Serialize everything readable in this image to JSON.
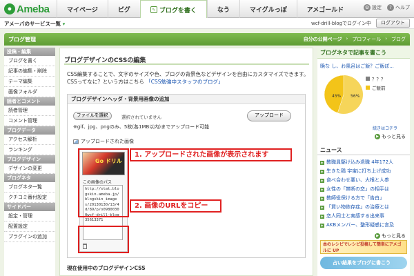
{
  "topnav": {
    "logo": "Ameba",
    "tabs": [
      "マイページ",
      "ピグ",
      "ブログを書く",
      "なう",
      "マイグルっぽ",
      "アメゴールド"
    ],
    "active_tab": "ブログを書く",
    "settings": "設定",
    "help": "ヘルプ"
  },
  "subbar": {
    "services": "アメーバのサービス一覧",
    "login_info": "wcf-drill-blogでログイン中",
    "logout": "ログアウト"
  },
  "bloghead": {
    "title": "ブログ管理",
    "links": [
      "自分の公開ページ",
      "プロフィール",
      "ブログ"
    ]
  },
  "sidebar": [
    {
      "head": "投稿・編集",
      "items": [
        "ブログを書く",
        "記事の編集・削除",
        "テーマ編集",
        "画像フォルダ"
      ]
    },
    {
      "head": "読者とコメント",
      "items": [
        "読者管理",
        "コメント管理"
      ]
    },
    {
      "head": "ブログデータ",
      "items": [
        "アクセス解析",
        "ランキング"
      ]
    },
    {
      "head": "ブログデザイン",
      "items": [
        "デザインの変更"
      ]
    },
    {
      "head": "ブログネタ",
      "items": [
        "ブログネタ一覧",
        "クチコミ番付設定"
      ]
    },
    {
      "head": "サイドバー",
      "items": [
        "設定・管理",
        "配置設定",
        "プラグインの追加"
      ]
    }
  ],
  "main": {
    "title": "ブログデザインのCSSの編集",
    "desc1": "CSS編集することで、文字のサイズや色、ブログの背景色などデザインを自由にカスタマイズできます。",
    "desc2_prefix": "CSSってなに？という方はこちら",
    "desc2_link": "「CSS勉強中スタッフのブログ」",
    "box_title": "ブログデザインヘッダ・背景用画像の追加",
    "file_button": "ファイルを選択",
    "no_file": "選択されていません",
    "upload_button": "アップロード",
    "format_note": "※gif、jpg、pngのみ、5枚(各1MB以内)までアップロード可能",
    "uploaded_label": "アップロードされた画像",
    "thumb_text": "Go ドリル",
    "path_label": "この画像のパス",
    "path_value": "http://stat.blogskin.ameba.jp/blogskin_images/20130130/13/4d/89/p/o09800300wcf-drill-blog35613371",
    "callout1": "1. アップロードされた画像が表示されます",
    "callout2": "2. 画像のURLをコピー",
    "current_css": "現在使用中のブログデザインCSS"
  },
  "right": {
    "title": "ブログネタで記事を書こう",
    "question": "晩な し、お風呂はご飯？ご飯ぽ...",
    "legend": [
      {
        "label": "？？？",
        "color": "#7f7f7f"
      },
      {
        "label": "ご飯前",
        "color": "#f3c419"
      }
    ],
    "pie": [
      {
        "label": "45%",
        "value": 45,
        "color": "#f3c419"
      },
      {
        "label": "56%",
        "value": 55,
        "color": "#f6d55a"
      }
    ],
    "small_more": "続きはコチラ",
    "more": "もっと見る",
    "news_title": "ニュース",
    "news": [
      "教職員駆け込み退職 4年172人",
      "生きた鶏 宇宙に打ち上げ成功",
      "食べ合わせ悪い、大根と人参",
      "女性の「禁断の恋」の相手は",
      "教師役保ける方で「告白」",
      "「買い物依存症」の治療とは",
      "恋人同士と実感する出来事",
      "AKBメンバー、整形疑惑に言及"
    ],
    "more2": "もっと見る",
    "banner1": "本のレシピでレシピ投稿して簡単にアメゴルに UP",
    "banner2": "占い結果をブログに書こう"
  }
}
